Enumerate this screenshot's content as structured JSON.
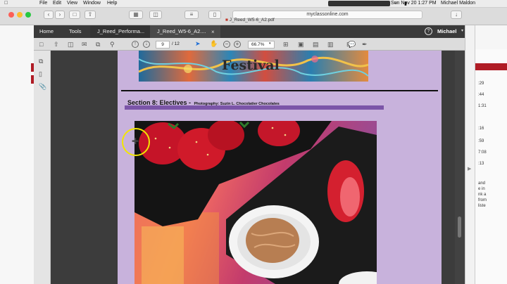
{
  "menubar": {
    "apple": "",
    "items": [
      "File",
      "Edit",
      "View",
      "Window",
      "Help"
    ],
    "clock": "Sun Nov 20  1:27 PM",
    "user": "Michael Maldon"
  },
  "browser": {
    "url": "myclassonline.com",
    "pdf_title": "J_Reed_W5-6_A2.pdf"
  },
  "acrobat": {
    "nav": [
      "Home",
      "Tools"
    ],
    "tabs": [
      "J_Reed_Performa...",
      "J_Reed_W5-6_A2...."
    ],
    "user": "Michael",
    "help": "?",
    "page_current": "9",
    "page_total": "/ 12",
    "zoom": "66.7%"
  },
  "document": {
    "banner_text": "Festival",
    "section_title": "Section 8: Electives -",
    "section_subtitle": "Photography: Suzin L. Chocolatier Chocolates"
  },
  "farright": {
    "lines": [
      ":29",
      ":44",
      "1:31",
      ":16",
      ":59",
      "7:08",
      ":13",
      "and",
      "e in",
      "nk a",
      "from",
      "liste"
    ]
  },
  "colors": {
    "page_purple": "#c8b2dc",
    "bar_purple": "#7b55a8",
    "app_dark": "#3a3a3a",
    "cursor_yellow": "#f2e600",
    "red_strip": "#b01c25"
  }
}
